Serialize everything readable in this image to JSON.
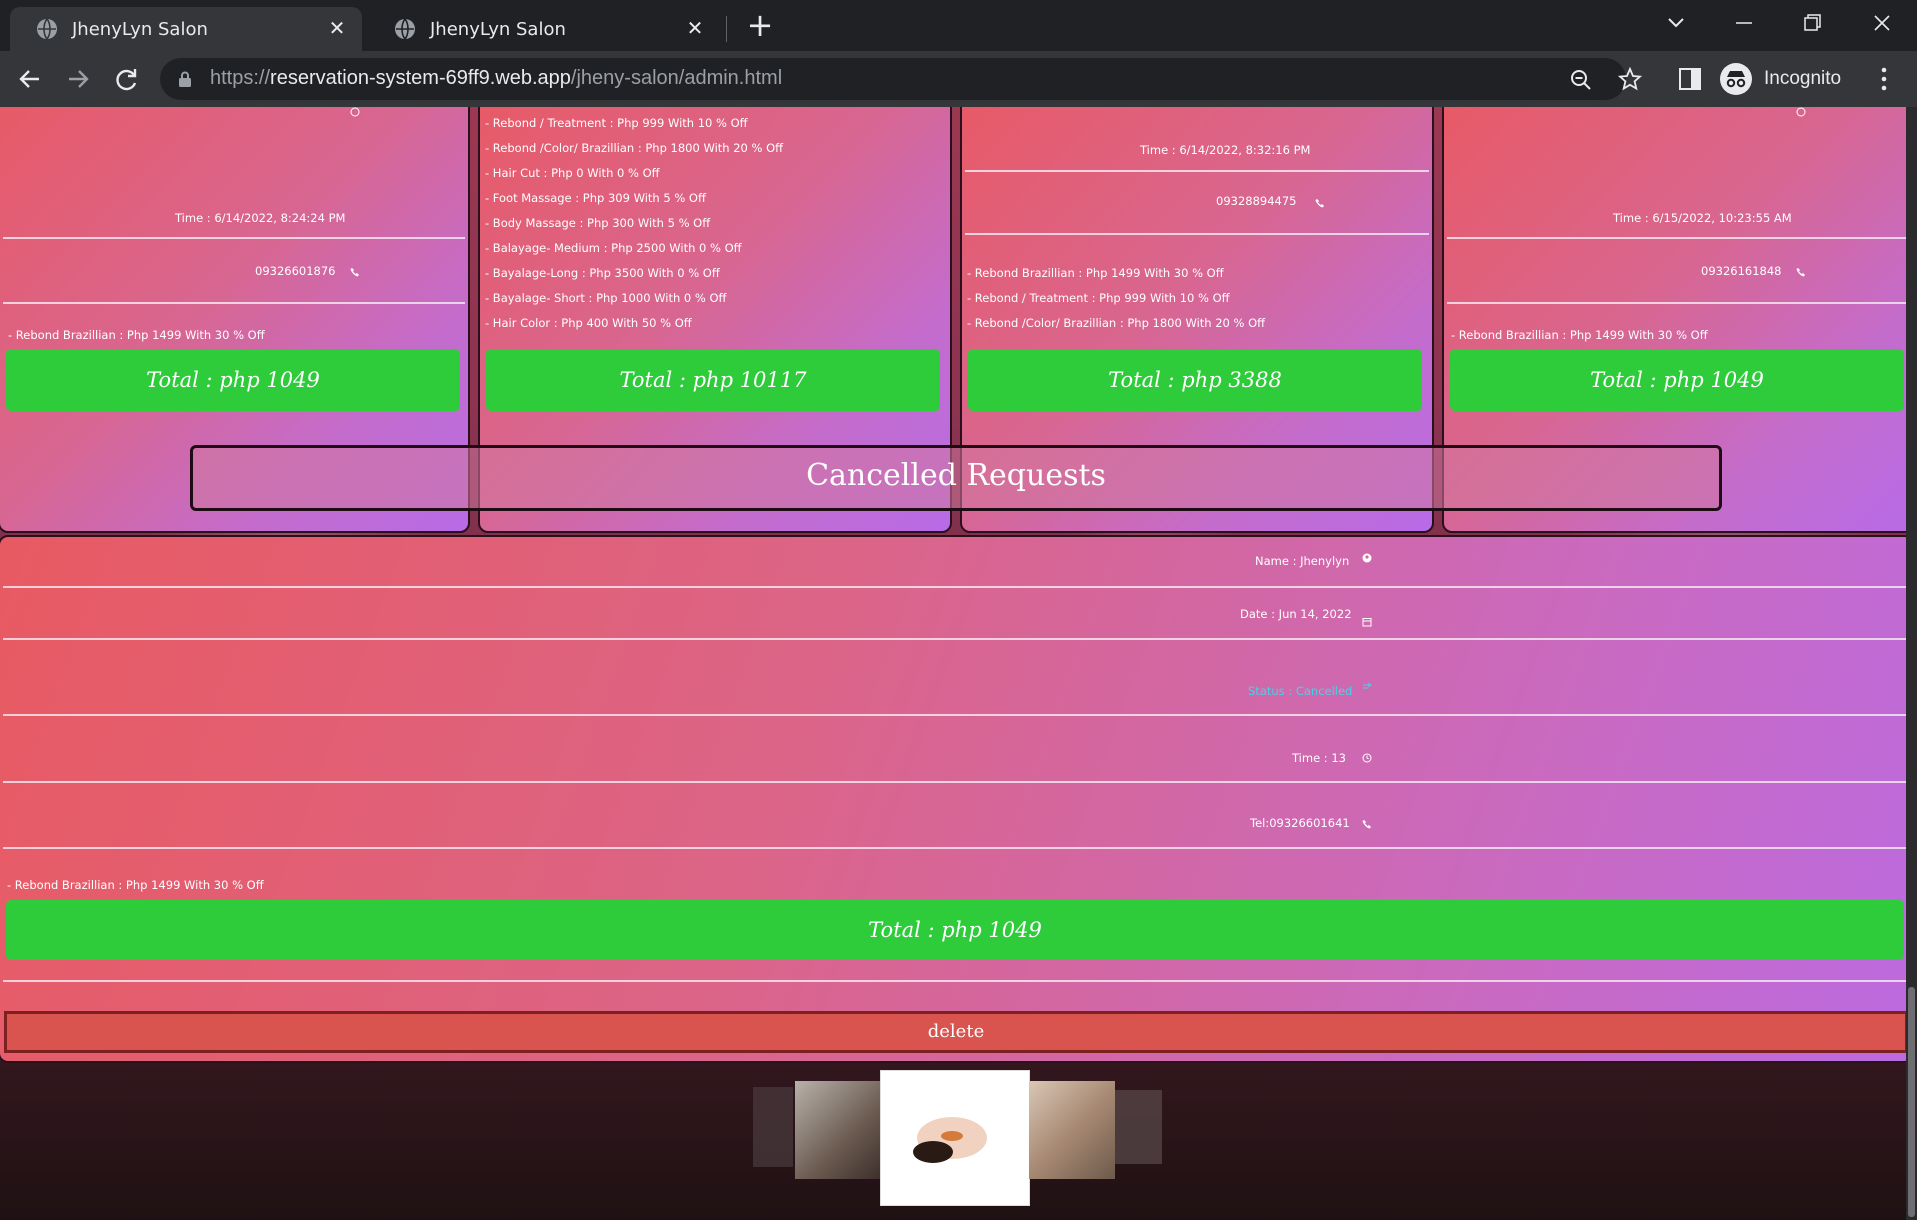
{
  "browser": {
    "tabs": [
      {
        "title": "JhenyLyn Salon"
      },
      {
        "title": "JhenyLyn Salon"
      }
    ],
    "url_scheme": "https://",
    "url_host": "reservation-system-69ff9.web.app",
    "url_path": "/jheny-salon/admin.html",
    "incognito_label": "Incognito"
  },
  "cards_top": [
    {
      "time": "Time : 6/14/2022, 8:24:24 PM",
      "phone": "09326601876",
      "services": [
        "- Rebond Brazillian : Php 1499 With 30 % Off"
      ],
      "total": "Total : php 1049"
    },
    {
      "services": [
        "- Rebond / Treatment : Php 999 With 10 % Off",
        "- Rebond /Color/ Brazillian : Php 1800 With 20 % Off",
        "- Hair Cut : Php 0 With 0 % Off",
        "- Foot Massage : Php 309 With 5 % Off",
        "- Body Massage : Php 300 With 5 % Off",
        "- Balayage- Medium : Php 2500 With 0 % Off",
        "- Bayalage-Long : Php 3500 With 0 % Off",
        "- Bayalage- Short : Php 1000 With 0 % Off",
        "- Hair Color : Php 400 With 50 % Off"
      ],
      "total": "Total : php 10117"
    },
    {
      "time": "Time : 6/14/2022, 8:32:16 PM",
      "phone": "09328894475",
      "services": [
        "- Rebond Brazillian : Php 1499 With 30 % Off",
        "- Rebond / Treatment : Php 999 With 10 % Off",
        "- Rebond /Color/ Brazillian : Php 1800 With 20 % Off"
      ],
      "total": "Total : php 3388"
    },
    {
      "time": "Time : 6/15/2022, 10:23:55 AM",
      "phone": "09326161848",
      "services": [
        "- Rebond Brazillian : Php 1499 With 30 % Off"
      ],
      "total": "Total : php 1049"
    }
  ],
  "cancelled": {
    "heading": "Cancelled Requests",
    "name": "Name : Jhenylyn",
    "date": "Date : Jun 14, 2022",
    "status": "Status : Cancelled",
    "time": "Time : 13",
    "tel": "Tel:09326601641",
    "services": [
      "- Rebond Brazillian : Php 1499 With 30 % Off"
    ],
    "total": "Total : php 1049",
    "delete_label": "delete"
  },
  "colors": {
    "total_green": "#2ecc3a",
    "delete_red": "#d9534f",
    "status_cyan": "#43d4e8"
  }
}
